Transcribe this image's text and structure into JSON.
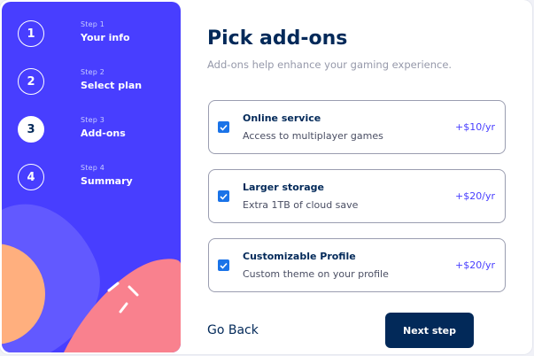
{
  "sidebar": {
    "steps": [
      {
        "number": "1",
        "label": "Step 1",
        "title": "Your info",
        "active": false
      },
      {
        "number": "2",
        "label": "Step 2",
        "title": "Select plan",
        "active": false
      },
      {
        "number": "3",
        "label": "Step 3",
        "title": "Add-ons",
        "active": true
      },
      {
        "number": "4",
        "label": "Step 4",
        "title": "Summary",
        "active": false
      }
    ]
  },
  "main": {
    "title": "Pick add-ons",
    "subtitle": "Add-ons help enhance your gaming experience.",
    "addons": [
      {
        "name": "Online service",
        "description": "Access to multiplayer games",
        "price": "+$10/yr",
        "checked": true
      },
      {
        "name": "Larger storage",
        "description": "Extra 1TB of cloud save",
        "price": "+$20/yr",
        "checked": true
      },
      {
        "name": "Customizable Profile",
        "description": "Custom theme on your profile",
        "price": "+$20/yr",
        "checked": true
      }
    ]
  },
  "footer": {
    "back_label": "Go Back",
    "next_label": "Next step"
  },
  "colors": {
    "sidebar_bg": "#483eff",
    "primary": "#022959",
    "accent": "#483eff",
    "checkbox": "#1a73e8"
  }
}
